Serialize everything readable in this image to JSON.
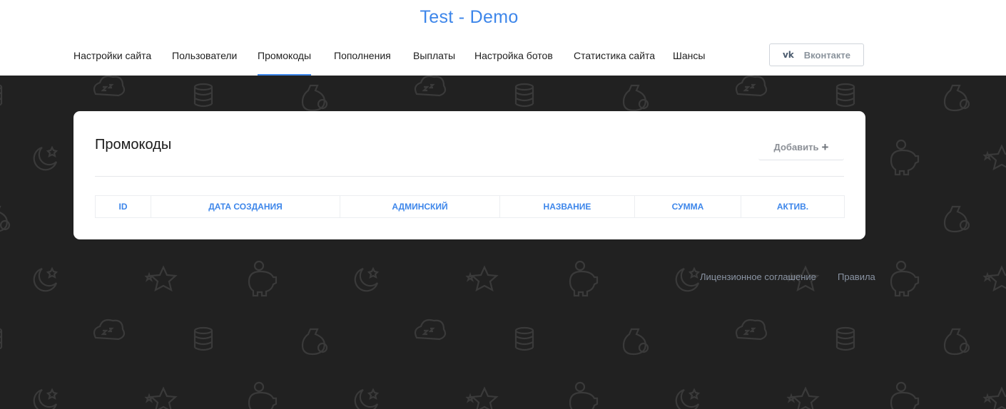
{
  "site": {
    "title": "Test - Demo"
  },
  "nav": {
    "items": [
      {
        "label": "Настройки сайта"
      },
      {
        "label": "Пользователи"
      },
      {
        "label": "Промокоды",
        "active": true
      },
      {
        "label": "Пополнения"
      },
      {
        "label": "Выплаты"
      },
      {
        "label": "Настройка ботов"
      },
      {
        "label": "Статистика сайта"
      },
      {
        "label": "Шансы"
      }
    ],
    "vk_icon": "vk",
    "vk_label": "Вконтакте"
  },
  "card": {
    "title": "Промокоды",
    "add_label": "Добавить",
    "add_icon": "+",
    "columns": [
      "ID",
      "ДАТА СОЗДАНИЯ",
      "АДМИНСКИЙ",
      "НАЗВАНИЕ",
      "СУММА",
      "АКТИВ."
    ]
  },
  "footer": {
    "license": "Лицензионное соглашение",
    "rules": "Правила"
  },
  "colors": {
    "accent": "#3d86ea",
    "background": "#212121",
    "pattern": "#3a3a3a"
  },
  "icons": [
    "sleep-cloud-icon",
    "coin-stack-icon",
    "money-bag-icon",
    "moon-stars-icon",
    "star-icon",
    "piggy-bank-icon"
  ]
}
